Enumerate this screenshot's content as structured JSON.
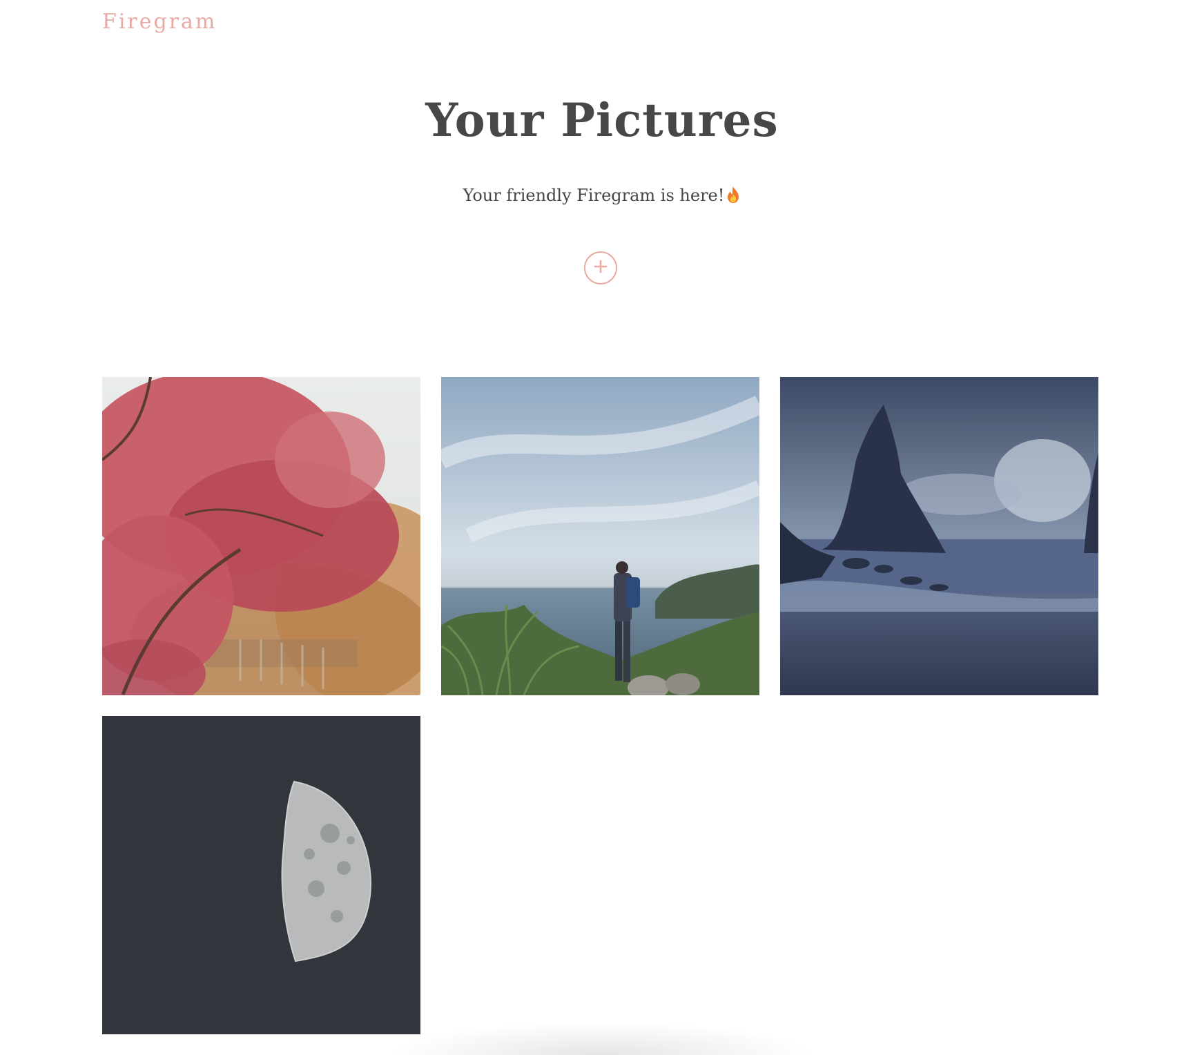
{
  "brand": {
    "name": "Firegram",
    "color": "#e8aaa2"
  },
  "hero": {
    "title": "Your Pictures",
    "subtitle": "Your friendly Firegram is here!",
    "subtitle_icon": "fire-icon"
  },
  "add_button": {
    "icon": "plus-icon"
  },
  "gallery": {
    "images": [
      {
        "subject": "red-maple-tree"
      },
      {
        "subject": "hiker-overlooking-sea"
      },
      {
        "subject": "sea-stacks-stormy-beach"
      },
      {
        "subject": "half-moon"
      }
    ]
  }
}
